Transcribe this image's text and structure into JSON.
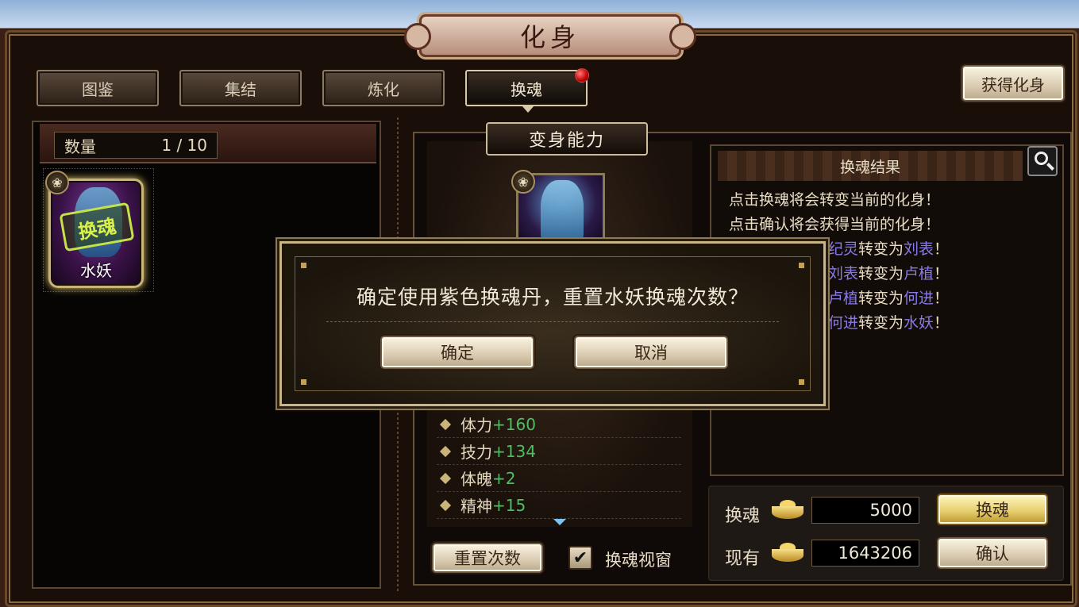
{
  "window": {
    "title": "化身"
  },
  "tabs": [
    {
      "label": "图鉴",
      "active": false
    },
    {
      "label": "集结",
      "active": false
    },
    {
      "label": "炼化",
      "active": false
    },
    {
      "label": "换魂",
      "active": true,
      "notification": true
    }
  ],
  "header": {
    "get_avatar_button": "获得化身"
  },
  "left_panel": {
    "count_label": "数量",
    "count_value": "1 / 10",
    "cards": [
      {
        "name": "水妖",
        "stamp": "换魂"
      }
    ]
  },
  "ability": {
    "title": "变身能力",
    "stats": [
      {
        "label": "体力",
        "value": "+160"
      },
      {
        "label": "技力",
        "value": "+134"
      },
      {
        "label": "体魄",
        "value": "+2"
      },
      {
        "label": "精神",
        "value": "+15"
      }
    ]
  },
  "result": {
    "title": "换魂结果",
    "lines": [
      {
        "text": "点击换魂将会转变当前的化身！"
      },
      {
        "text": "点击确认将会获得当前的化身！"
      },
      {
        "a": "纪灵",
        "mid": "转变为",
        "b": "刘表",
        "end": "！"
      },
      {
        "a": "刘表",
        "mid": "转变为",
        "b": "卢植",
        "end": "！"
      },
      {
        "a": "卢植",
        "mid": "转变为",
        "b": "何进",
        "end": "！"
      },
      {
        "a": "何进",
        "mid": "转变为",
        "b": "水妖",
        "end": "！"
      }
    ]
  },
  "controls": {
    "reset_button": "重置次数",
    "checkbox_label": "换魂视窗",
    "checkbox_checked": true,
    "swap_label": "换魂",
    "swap_cost": "5000",
    "swap_button": "换魂",
    "owned_label": "现有",
    "owned_amount": "1643206",
    "confirm_button": "确认"
  },
  "dialog": {
    "message": "确定使用紫色换魂丹，重置水妖换魂次数？",
    "ok": "确定",
    "cancel": "取消"
  },
  "colors": {
    "highlight_name": "#8a7ae8",
    "stat_bonus": "#4cc060",
    "notification": "#c00000"
  }
}
